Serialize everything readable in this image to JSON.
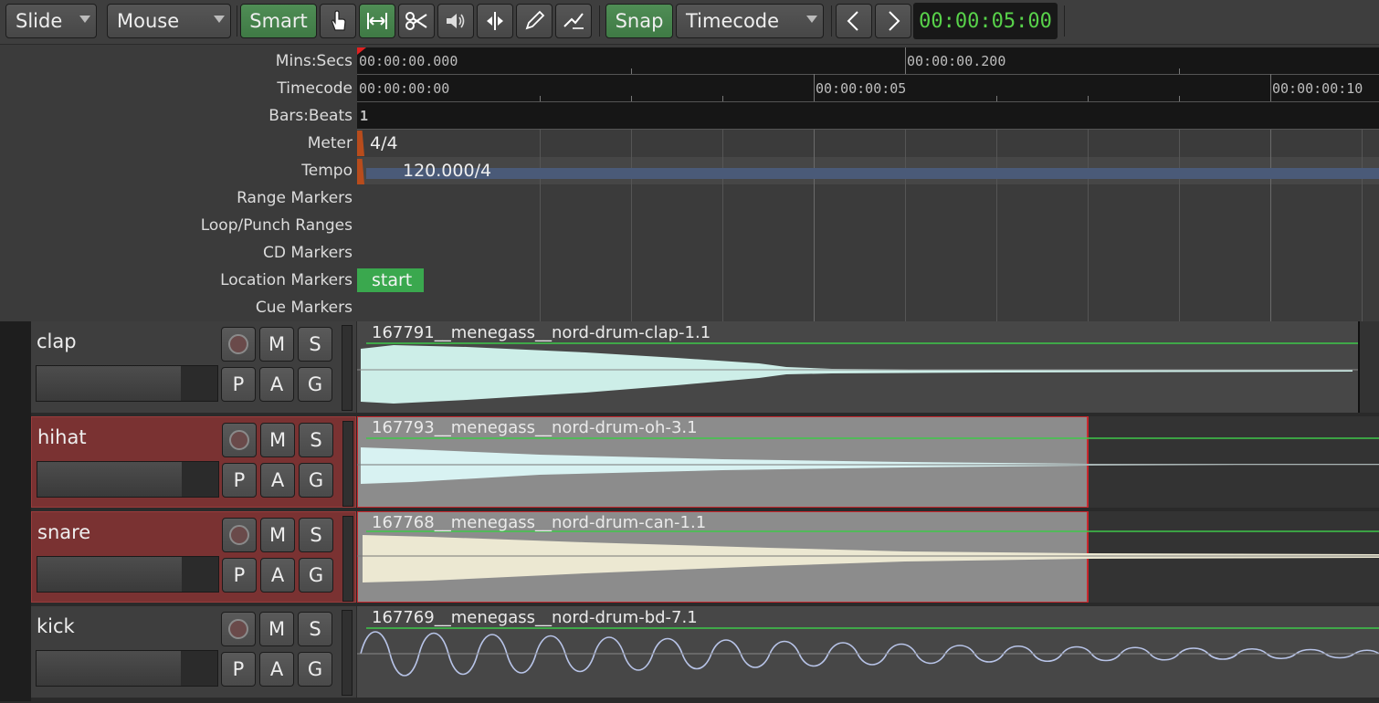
{
  "toolbar": {
    "edit_mode": "Slide",
    "input_mode": "Mouse",
    "smart_label": "Smart",
    "snap_label": "Snap",
    "snap_mode": "Timecode",
    "clock": "00:00:05:00"
  },
  "rulers": {
    "labels": {
      "mins_secs": "Mins:Secs",
      "timecode": "Timecode",
      "bars_beats": "Bars:Beats",
      "meter": "Meter",
      "tempo": "Tempo",
      "range_markers": "Range Markers",
      "loop_punch": "Loop/Punch Ranges",
      "cd_markers": "CD Markers",
      "location_markers": "Location Markers",
      "cue_markers": "Cue Markers"
    },
    "mins_secs_ticks": [
      "00:00:00.000",
      "00:00:00.200"
    ],
    "timecode_ticks": [
      "00:00:00:00",
      "00:00:00:05",
      "00:00:00:10"
    ],
    "bars_beats_first": "1",
    "meter_value": "4/4",
    "tempo_value": "120.000/4",
    "location_marker": "start"
  },
  "tracks": [
    {
      "name": "clap",
      "region": "167791__menegass__nord-drum-clap-1.1",
      "selected": false
    },
    {
      "name": "hihat",
      "region": "167793__menegass__nord-drum-oh-3.1",
      "selected": true
    },
    {
      "name": "snare",
      "region": "167768__menegass__nord-drum-can-1.1",
      "selected": true
    },
    {
      "name": "kick",
      "region": "167769__menegass__nord-drum-bd-7.1",
      "selected": false
    }
  ],
  "track_buttons": {
    "mute": "M",
    "solo": "S",
    "playlist": "P",
    "automation": "A",
    "group": "G"
  },
  "colors": {
    "accent_green": "#4f8d55",
    "clock_text": "#58d24a",
    "selected_track": "#7a3232",
    "marker": "#3aa84e"
  }
}
